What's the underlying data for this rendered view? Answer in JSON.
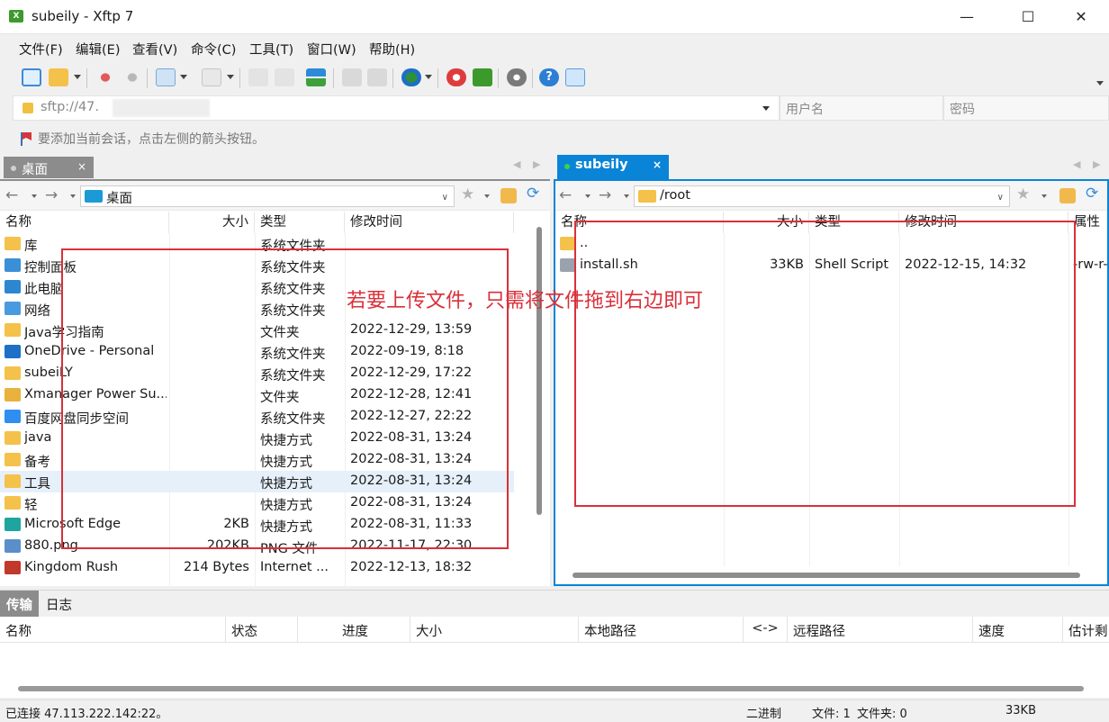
{
  "window": {
    "title": "subeily - Xftp 7",
    "app_icon_glyph": "X",
    "minimize_glyph": "—",
    "maximize_glyph": "☐",
    "close_glyph": "✕"
  },
  "menu": [
    "文件(F)",
    "编辑(E)",
    "查看(V)",
    "命令(C)",
    "工具(T)",
    "窗口(W)",
    "帮助(H)"
  ],
  "address": {
    "url_prefix": "sftp://47.",
    "user_placeholder": "用户名",
    "password_placeholder": "密码",
    "hint": "要添加当前会话，点击左侧的箭头按钮。"
  },
  "tabs": {
    "local": {
      "label": "桌面",
      "close": "×"
    },
    "remote": {
      "label": "subeily",
      "close": "×"
    }
  },
  "nav": {
    "back_glyph": "←",
    "forward_glyph": "→",
    "star_glyph": "★",
    "refresh_glyph": "⟳"
  },
  "local_pane": {
    "path": "桌面",
    "columns": {
      "name": "名称",
      "size": "大小",
      "type": "类型",
      "modified": "修改时间"
    },
    "files": [
      {
        "name": "库",
        "size": "",
        "type": "系统文件夹",
        "modified": "",
        "icon": "library-folder-icon",
        "color": "#f4c14a"
      },
      {
        "name": "控制面板",
        "size": "",
        "type": "系统文件夹",
        "modified": "",
        "icon": "control-panel-icon",
        "color": "#3b8fd6"
      },
      {
        "name": "此电脑",
        "size": "",
        "type": "系统文件夹",
        "modified": "",
        "icon": "computer-icon",
        "color": "#2c86d0"
      },
      {
        "name": "网络",
        "size": "",
        "type": "系统文件夹",
        "modified": "",
        "icon": "network-icon",
        "color": "#4a9adf"
      },
      {
        "name": "Java学习指南",
        "size": "",
        "type": "文件夹",
        "modified": "2022-12-29, 13:59",
        "icon": "folder-icon",
        "color": "#f4c14a"
      },
      {
        "name": "OneDrive - Personal",
        "size": "",
        "type": "系统文件夹",
        "modified": "2022-09-19, 8:18",
        "icon": "onedrive-icon",
        "color": "#1d6fc8"
      },
      {
        "name": "subeiLY",
        "size": "",
        "type": "系统文件夹",
        "modified": "2022-12-29, 17:22",
        "icon": "folder-icon",
        "color": "#f4c14a"
      },
      {
        "name": "Xmanager Power Su...",
        "size": "",
        "type": "文件夹",
        "modified": "2022-12-28, 12:41",
        "icon": "xmanager-icon",
        "color": "#e8b23c"
      },
      {
        "name": "百度网盘同步空间",
        "size": "",
        "type": "系统文件夹",
        "modified": "2022-12-27, 22:22",
        "icon": "baidu-netdisk-icon",
        "color": "#2f8ff0"
      },
      {
        "name": "java",
        "size": "",
        "type": "快捷方式",
        "modified": "2022-08-31, 13:24",
        "icon": "shortcut-folder-icon",
        "color": "#f4c14a"
      },
      {
        "name": "备考",
        "size": "",
        "type": "快捷方式",
        "modified": "2022-08-31, 13:24",
        "icon": "shortcut-folder-icon",
        "color": "#f4c14a"
      },
      {
        "name": "工具",
        "size": "",
        "type": "快捷方式",
        "modified": "2022-08-31, 13:24",
        "icon": "shortcut-folder-icon",
        "color": "#f4c14a"
      },
      {
        "name": "轻",
        "size": "",
        "type": "快捷方式",
        "modified": "2022-08-31, 13:24",
        "icon": "shortcut-folder-icon",
        "color": "#f4c14a"
      },
      {
        "name": "Microsoft Edge",
        "size": "2KB",
        "type": "快捷方式",
        "modified": "2022-08-31, 11:33",
        "icon": "edge-icon",
        "color": "#1fa5a0"
      },
      {
        "name": "880.png",
        "size": "202KB",
        "type": "PNG 文件",
        "modified": "2022-11-17, 22:30",
        "icon": "image-file-icon",
        "color": "#5a8fc9"
      },
      {
        "name": "Kingdom Rush",
        "size": "214 Bytes",
        "type": "Internet ...",
        "modified": "2022-12-13, 18:32",
        "icon": "game-shortcut-icon",
        "color": "#c0392b"
      }
    ],
    "selected_index": 11
  },
  "remote_pane": {
    "path": "/root",
    "columns": {
      "name": "名称",
      "size": "大小",
      "type": "类型",
      "modified": "修改时间",
      "attrs": "属性"
    },
    "files": [
      {
        "name": "..",
        "size": "",
        "type": "",
        "modified": "",
        "attrs": "",
        "icon": "parent-folder-icon",
        "color": "#f4c14a"
      },
      {
        "name": "install.sh",
        "size": "33KB",
        "type": "Shell Script",
        "modified": "2022-12-15, 14:32",
        "attrs": "-rw-r--",
        "icon": "script-file-icon",
        "color": "#9aa3ad"
      }
    ]
  },
  "annotation": {
    "text": "若要上传文件，只需将文件拖到右边即可",
    "color": "#d9303a"
  },
  "bottom": {
    "tabs": [
      "传输",
      "日志"
    ],
    "columns": [
      "名称",
      "状态",
      "进度",
      "大小",
      "本地路径",
      "<->",
      "远程路径",
      "速度",
      "估计剩"
    ]
  },
  "status": {
    "connection": "已连接 47.113.222.142:22。",
    "mode": "二进制",
    "files": "文件: 1",
    "folders": "文件夹: 0",
    "size": "33KB"
  },
  "colors": {
    "accent": "#0a84d6",
    "inactive_tab": "#8c8c8c",
    "annotation": "#d9303a"
  }
}
